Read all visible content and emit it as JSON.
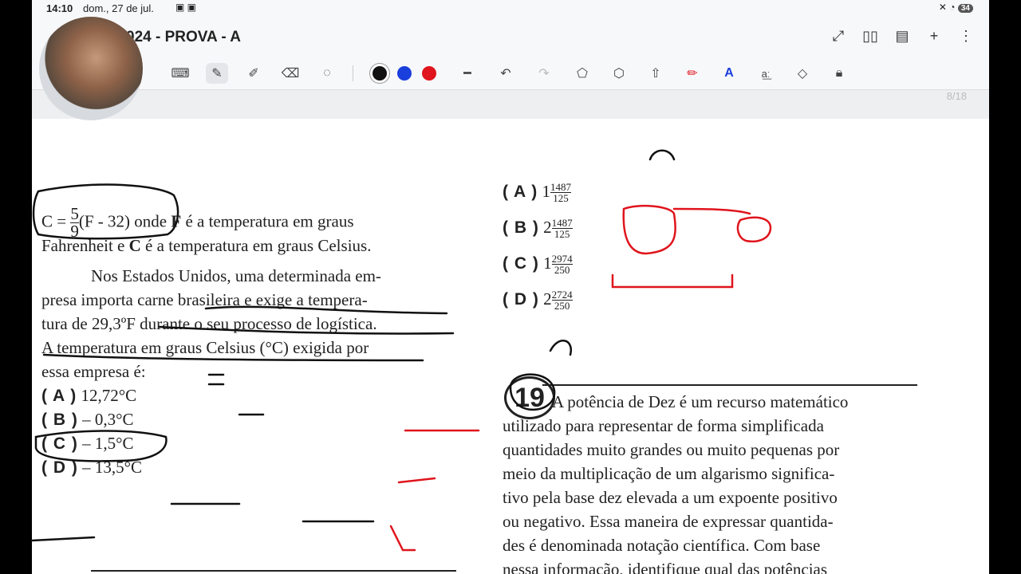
{
  "status": {
    "time": "14:10",
    "date": "dom., 27 de jul.",
    "battery": "34"
  },
  "header": {
    "title": "024 - PROVA - A"
  },
  "page_indicator": "8/18",
  "toolbar": {
    "colors": {
      "black": "#111111",
      "blue": "#1a3fdc",
      "red": "#e0141c"
    },
    "icons": [
      "keyboard-icon",
      "pen-icon",
      "highlighter-icon",
      "eraser-icon",
      "lasso-icon",
      "line-width-icon",
      "undo-icon",
      "redo-icon",
      "shape-icon",
      "shape-alt-icon",
      "arrow-shape-icon",
      "marker-icon",
      "text-icon",
      "ocr-icon",
      "shapes-icon",
      "lock-icon"
    ]
  },
  "question18": {
    "formula_prefix": "C =",
    "formula_num": "5",
    "formula_den": "9",
    "formula_suffix": "(F - 32)",
    "line1_rest": "onde",
    "bold_F": "F",
    "line1_tail": "é a temperatura em graus",
    "line2a": "Fahrenheit e",
    "bold_C": "C",
    "line2b": "é a temperatura em graus Celsius.",
    "p2_l1": "Nos Estados Unidos, uma determinada em-",
    "p2_l2": "presa importa carne brasileira e exige a tempera-",
    "p2_l3": "tura de 29,3ºF durante o seu processo de logística.",
    "p2_l4": "A temperatura em graus Celsius (°C) exigida por",
    "p2_l5": "essa empresa é:",
    "options": [
      {
        "letter": "( A )",
        "text": "12,72°C"
      },
      {
        "letter": "( B )",
        "text": "– 0,3°C"
      },
      {
        "letter": "( C )",
        "text": "– 1,5°C"
      },
      {
        "letter": "( D )",
        "text": "– 13,5°C"
      }
    ]
  },
  "question17_options": [
    {
      "letter": "( A )",
      "base": "1",
      "num": "1487",
      "den": "125"
    },
    {
      "letter": "( B )",
      "base": "2",
      "num": "1487",
      "den": "125"
    },
    {
      "letter": "( C )",
      "base": "1",
      "num": "2974",
      "den": "250"
    },
    {
      "letter": "( D )",
      "base": "2",
      "num": "2724",
      "den": "250"
    }
  ],
  "question19": {
    "number": "19",
    "l1": "A potência de Dez é um recurso matemático",
    "l2": "utilizado para representar de forma simplificada",
    "l3": "quantidades muito grandes ou muito pequenas por",
    "l4": "meio da multiplicação de um algarismo significa-",
    "l5": "tivo pela base dez elevada a um expoente positivo",
    "l6": "ou negativo. Essa maneira de expressar quantida-",
    "l7": "des é denominada notação científica. Com base",
    "l8": "nessa informação, identifique qual das potências"
  }
}
